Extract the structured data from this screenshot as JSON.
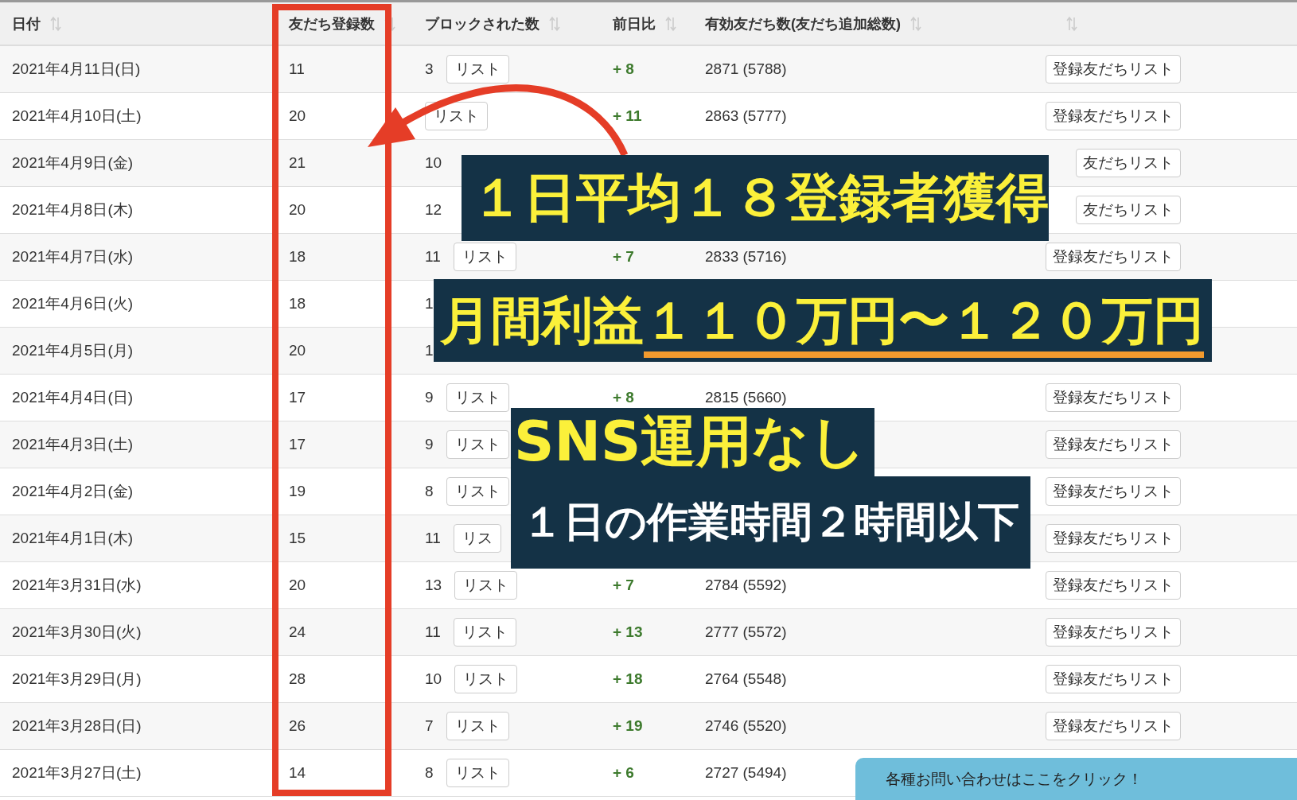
{
  "table": {
    "columns": [
      {
        "label": "日付"
      },
      {
        "label": "友だち登録数"
      },
      {
        "label": "ブロックされた数"
      },
      {
        "label": "前日比"
      },
      {
        "label": "有効友だち数(友だち追加総数)"
      },
      {}
    ],
    "rows": [
      {
        "date": "2021年4月11日(日)",
        "friends": "11",
        "blocked": "3",
        "list_button": "リスト",
        "diff": "+ 8",
        "total": "2871 (5788)",
        "friends_list_button": "登録友だちリスト"
      },
      {
        "date": "2021年4月10日(土)",
        "friends": "20",
        "list_button": "リスト",
        "diff": "+ 11",
        "total": "2863 (5777)",
        "friends_list_button": "登録友だちリスト"
      },
      {
        "date": "2021年4月9日(金)",
        "friends": "21",
        "blocked": "10",
        "friends_list_button": "友だちリスト"
      },
      {
        "date": "2021年4月8日(木)",
        "friends": "20",
        "blocked": "12",
        "friends_list_button": "友だちリスト"
      },
      {
        "date": "2021年4月7日(水)",
        "friends": "18",
        "blocked": "11",
        "list_button": "リスト",
        "diff": "+ 7",
        "total": "2833 (5716)",
        "friends_list_button": "登録友だちリスト"
      },
      {
        "date": "2021年4月6日(火)",
        "friends": "18",
        "blocked": "1"
      },
      {
        "date": "2021年4月5日(月)",
        "friends": "20",
        "blocked": "1"
      },
      {
        "date": "2021年4月4日(日)",
        "friends": "17",
        "blocked": "9",
        "list_button": "リスト",
        "diff": "+ 8",
        "total": "2815 (5660)",
        "friends_list_button": "登録友だちリスト"
      },
      {
        "date": "2021年4月3日(土)",
        "friends": "17",
        "blocked": "9",
        "list_button": "リスト",
        "friends_list_button": "登録友だちリスト"
      },
      {
        "date": "2021年4月2日(金)",
        "friends": "19",
        "blocked": "8",
        "list_button": "リスト",
        "friends_list_button": "登録友だちリスト"
      },
      {
        "date": "2021年4月1日(木)",
        "friends": "15",
        "blocked": "11",
        "list_button": "リス",
        "friends_list_button": "登録友だちリスト"
      },
      {
        "date": "2021年3月31日(水)",
        "friends": "20",
        "blocked": "13",
        "list_button": "リスト",
        "diff": "+ 7",
        "total": "2784 (5592)",
        "friends_list_button": "登録友だちリスト"
      },
      {
        "date": "2021年3月30日(火)",
        "friends": "24",
        "blocked": "11",
        "list_button": "リスト",
        "diff": "+ 13",
        "total": "2777 (5572)",
        "friends_list_button": "登録友だちリスト"
      },
      {
        "date": "2021年3月29日(月)",
        "friends": "28",
        "blocked": "10",
        "list_button": "リスト",
        "diff": "+ 18",
        "total": "2764 (5548)",
        "friends_list_button": "登録友だちリスト"
      },
      {
        "date": "2021年3月28日(日)",
        "friends": "26",
        "blocked": "7",
        "list_button": "リスト",
        "diff": "+ 19",
        "total": "2746 (5520)",
        "friends_list_button": "登録友だちリスト"
      },
      {
        "date": "2021年3月27日(土)",
        "friends": "14",
        "blocked": "8",
        "list_button": "リスト",
        "diff": "+ 6",
        "total": "2727 (5494)"
      }
    ]
  },
  "banners": [
    {
      "kind": "headline",
      "text": "１日平均１８登録者獲得"
    },
    {
      "kind": "headline",
      "text": "月間利益",
      "underlined_text": "１１０万円〜１２０万円"
    },
    {
      "kind": "headline",
      "text": "SNS運用なし"
    },
    {
      "kind": "sub",
      "text": "１日の作業時間２時間以下"
    }
  ],
  "contact_button": "各種お問い合わせはここをクリック！"
}
